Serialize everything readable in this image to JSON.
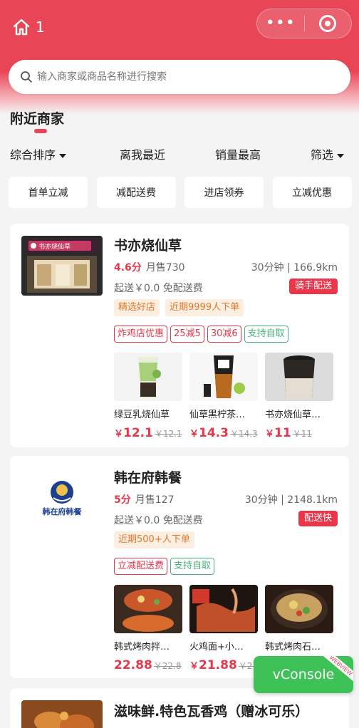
{
  "header": {
    "page_count": "1",
    "menu_icon": "more-dots-icon",
    "close_icon": "target-circle-icon",
    "accent": "#e84556"
  },
  "search": {
    "placeholder": "输入商家或商品名称进行搜索"
  },
  "section": {
    "title": "附近商家"
  },
  "sort": {
    "comprehensive": "综合排序",
    "nearest": "离我最近",
    "best_selling": "销量最高",
    "filter": "筛选"
  },
  "chips": [
    "首单立减",
    "减配送费",
    "进店领券",
    "立减优惠"
  ],
  "shops": [
    {
      "name": "书亦烧仙草",
      "sign_text": "书亦烧仙草",
      "score": "4.6分",
      "sales": "月售730",
      "eta": "30分钟 | 166.9km",
      "fee": "起送￥0.0 免配送费",
      "delivery_badge": "骑手配送",
      "tags": [
        "精选好店",
        "近期9999人下单"
      ],
      "promos": [
        "炸鸡店优惠",
        "25减5",
        "30减6"
      ],
      "pickup": "支持自取",
      "products": [
        {
          "name": "绿豆乳烧仙草",
          "currency": "￥",
          "price": "12.1",
          "old": "￥12.1"
        },
        {
          "name": "仙草黑柠茶…",
          "currency": "￥",
          "price": "14.3",
          "old": "￥14.3"
        },
        {
          "name": "书亦烧仙草…",
          "currency": "￥",
          "price": "11",
          "old": "￥11"
        }
      ]
    },
    {
      "name": "韩在府韩餐",
      "logo_text": "韩在府韩餐",
      "score": "5分",
      "sales": "月售127",
      "eta": "30分钟 | 2148.1km",
      "fee": "起送￥0.0 免配送费",
      "delivery_badge": "配送快",
      "tags": [
        "近期500+人下单"
      ],
      "promos": [
        "立减配送费"
      ],
      "pickup": "支持自取",
      "products": [
        {
          "name": "韩式烤肉拌…",
          "currency": "",
          "price": "22.88",
          "old": "￥22.8"
        },
        {
          "name": "火鸡面+小…",
          "currency": "￥",
          "price": "21.88",
          "old": "￥21."
        },
        {
          "name": "韩式烤肉石…",
          "currency": "",
          "price": "",
          "old": ""
        }
      ]
    },
    {
      "name": "滋味鲜.特色瓦香鸡（赠冰可乐）"
    }
  ],
  "vconsole": {
    "label": "vConsole",
    "ribbon": "WEBVIEW"
  }
}
